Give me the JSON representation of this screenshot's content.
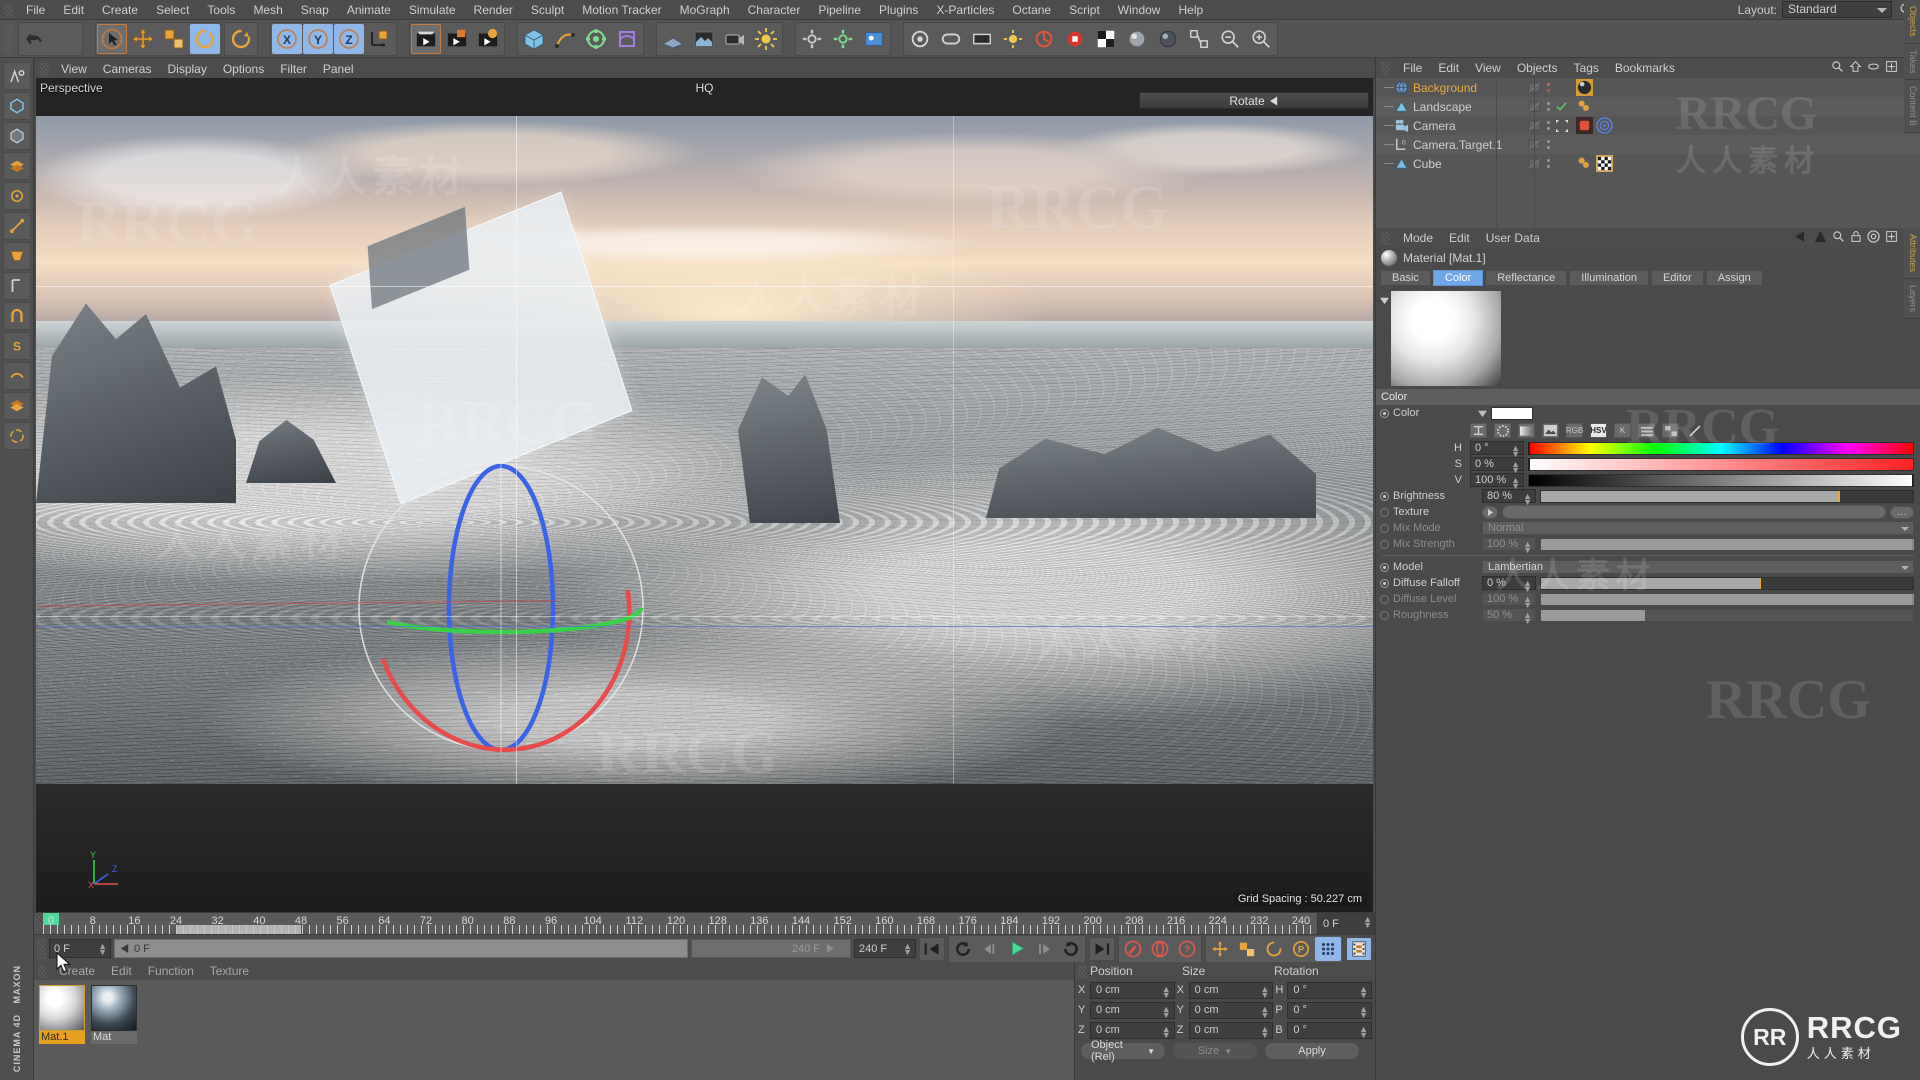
{
  "menubar": {
    "items": [
      "File",
      "Edit",
      "Create",
      "Select",
      "Tools",
      "Mesh",
      "Snap",
      "Animate",
      "Simulate",
      "Render",
      "Sculpt",
      "Motion Tracker",
      "MoGraph",
      "Character",
      "Pipeline",
      "Plugins",
      "X-Particles",
      "Octane",
      "Script",
      "Window",
      "Help"
    ],
    "layout_label": "Layout:",
    "layout_value": "Standard"
  },
  "viewport": {
    "menu": [
      "View",
      "Cameras",
      "Display",
      "Options",
      "Filter",
      "Panel"
    ],
    "label": "Perspective",
    "hq": "HQ",
    "rotate": "Rotate",
    "grid_spacing": "Grid Spacing : 50.227 cm",
    "axis_x": "X",
    "axis_y": "Y",
    "axis_z": "Z"
  },
  "timeline": {
    "ticks": [
      "0",
      "8",
      "16",
      "24",
      "32",
      "40",
      "48",
      "56",
      "64",
      "72",
      "80",
      "88",
      "96",
      "104",
      "112",
      "120",
      "128",
      "136",
      "144",
      "152",
      "160",
      "168",
      "176",
      "184",
      "192",
      "200",
      "208",
      "216",
      "224",
      "232",
      "240"
    ],
    "current_frame": "0 F"
  },
  "transport": {
    "frame_start": "0 F",
    "track_value": "0 F",
    "range_end": "240 F",
    "frame_end": "240 F"
  },
  "material_manager": {
    "menu": [
      "Create",
      "Edit",
      "Function",
      "Texture"
    ],
    "materials": [
      {
        "name": "Mat.1",
        "selected": true
      },
      {
        "name": "Mat",
        "selected": false
      }
    ]
  },
  "coordinates": {
    "headers": [
      "Position",
      "Size",
      "Rotation"
    ],
    "position": [
      {
        "axis": "X",
        "value": "0 cm"
      },
      {
        "axis": "Y",
        "value": "0 cm"
      },
      {
        "axis": "Z",
        "value": "0 cm"
      }
    ],
    "size": [
      {
        "axis": "X",
        "value": "0 cm"
      },
      {
        "axis": "Y",
        "value": "0 cm"
      },
      {
        "axis": "Z",
        "value": "0 cm"
      }
    ],
    "rotation": [
      {
        "axis": "H",
        "value": "0 °"
      },
      {
        "axis": "P",
        "value": "0 °"
      },
      {
        "axis": "B",
        "value": "0 °"
      }
    ],
    "mode": "Object (Rel)",
    "size_mode": "Size",
    "apply": "Apply"
  },
  "object_manager": {
    "menu": [
      "File",
      "Edit",
      "View",
      "Objects",
      "Tags",
      "Bookmarks"
    ],
    "objects": [
      {
        "name": "Background",
        "selected": true
      },
      {
        "name": "Landscape",
        "selected": false
      },
      {
        "name": "Camera",
        "selected": false
      },
      {
        "name": "Camera.Target.1",
        "selected": false
      },
      {
        "name": "Cube",
        "selected": false
      }
    ],
    "side_tabs": [
      "Objects",
      "Takes",
      "Content B"
    ]
  },
  "attributes": {
    "menu": [
      "Mode",
      "Edit",
      "User Data"
    ],
    "title": "Material [Mat.1]",
    "tabs": [
      {
        "label": "Basic",
        "active": false
      },
      {
        "label": "Color",
        "active": true
      },
      {
        "label": "Reflectance",
        "active": false
      },
      {
        "label": "Illumination",
        "active": false
      },
      {
        "label": "Editor",
        "active": false
      },
      {
        "label": "Assign",
        "active": false
      }
    ],
    "section_color": "Color",
    "color_label": "Color",
    "color_value": "#ffffff",
    "color_modes": [
      "RGB",
      "HSV",
      "K"
    ],
    "active_color_mode": "HSV",
    "hsv": [
      {
        "label": "H",
        "value": "0 °",
        "pct": 0
      },
      {
        "label": "S",
        "value": "0 %",
        "pct": 0
      },
      {
        "label": "V",
        "value": "100 %",
        "pct": 100
      }
    ],
    "brightness": {
      "label": "Brightness",
      "value": "80 %",
      "pct": 80
    },
    "texture": {
      "label": "Texture",
      "value": ""
    },
    "mix_mode": {
      "label": "Mix Mode",
      "value": "Normal"
    },
    "mix_strength": {
      "label": "Mix Strength",
      "value": "100 %",
      "pct": 100
    },
    "model": {
      "label": "Model",
      "value": "Lambertian"
    },
    "diffuse_falloff": {
      "label": "Diffuse Falloff",
      "value": "0 %",
      "pct": 59
    },
    "diffuse_level": {
      "label": "Diffuse Level",
      "value": "100 %",
      "pct": 100
    },
    "roughness": {
      "label": "Roughness",
      "value": "50 %",
      "pct": 28
    },
    "side_tabs": [
      "Attributes",
      "Layers"
    ]
  },
  "branding": {
    "maxon": "MAXON",
    "cinema": "CINEMA 4D",
    "watermark_text": "人人素材",
    "watermark_rrcg": "RRCG",
    "logo_title": "RRCG",
    "logo_sub": "人人素材",
    "logo_mark": "RR"
  },
  "colors": {
    "accent_blue": "#6fa8e8",
    "accent_orange": "#e8a020",
    "panel_bg": "#4a4a4a",
    "selected_text": "#e9a93a"
  }
}
